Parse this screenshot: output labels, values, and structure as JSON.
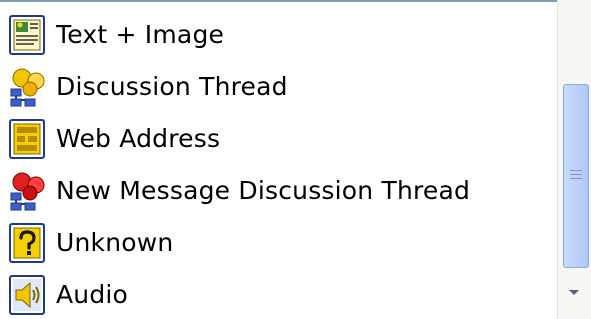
{
  "list": {
    "items": [
      {
        "label": "Text + Image",
        "icon": "text-image-icon"
      },
      {
        "label": "Discussion Thread",
        "icon": "discussion-thread-icon"
      },
      {
        "label": "Web Address",
        "icon": "web-address-icon"
      },
      {
        "label": "New Message Discussion Thread",
        "icon": "new-message-discussion-thread-icon"
      },
      {
        "label": "Unknown",
        "icon": "unknown-icon"
      },
      {
        "label": "Audio",
        "icon": "audio-icon"
      }
    ]
  },
  "colors": {
    "frame_border": "#7f9db9",
    "scroll_thumb": "#bfd3fa",
    "scroll_track": "#f7f7f3",
    "icon_yellow": "#f5c400",
    "icon_blue": "#3a5fcd",
    "icon_red": "#e02020"
  }
}
